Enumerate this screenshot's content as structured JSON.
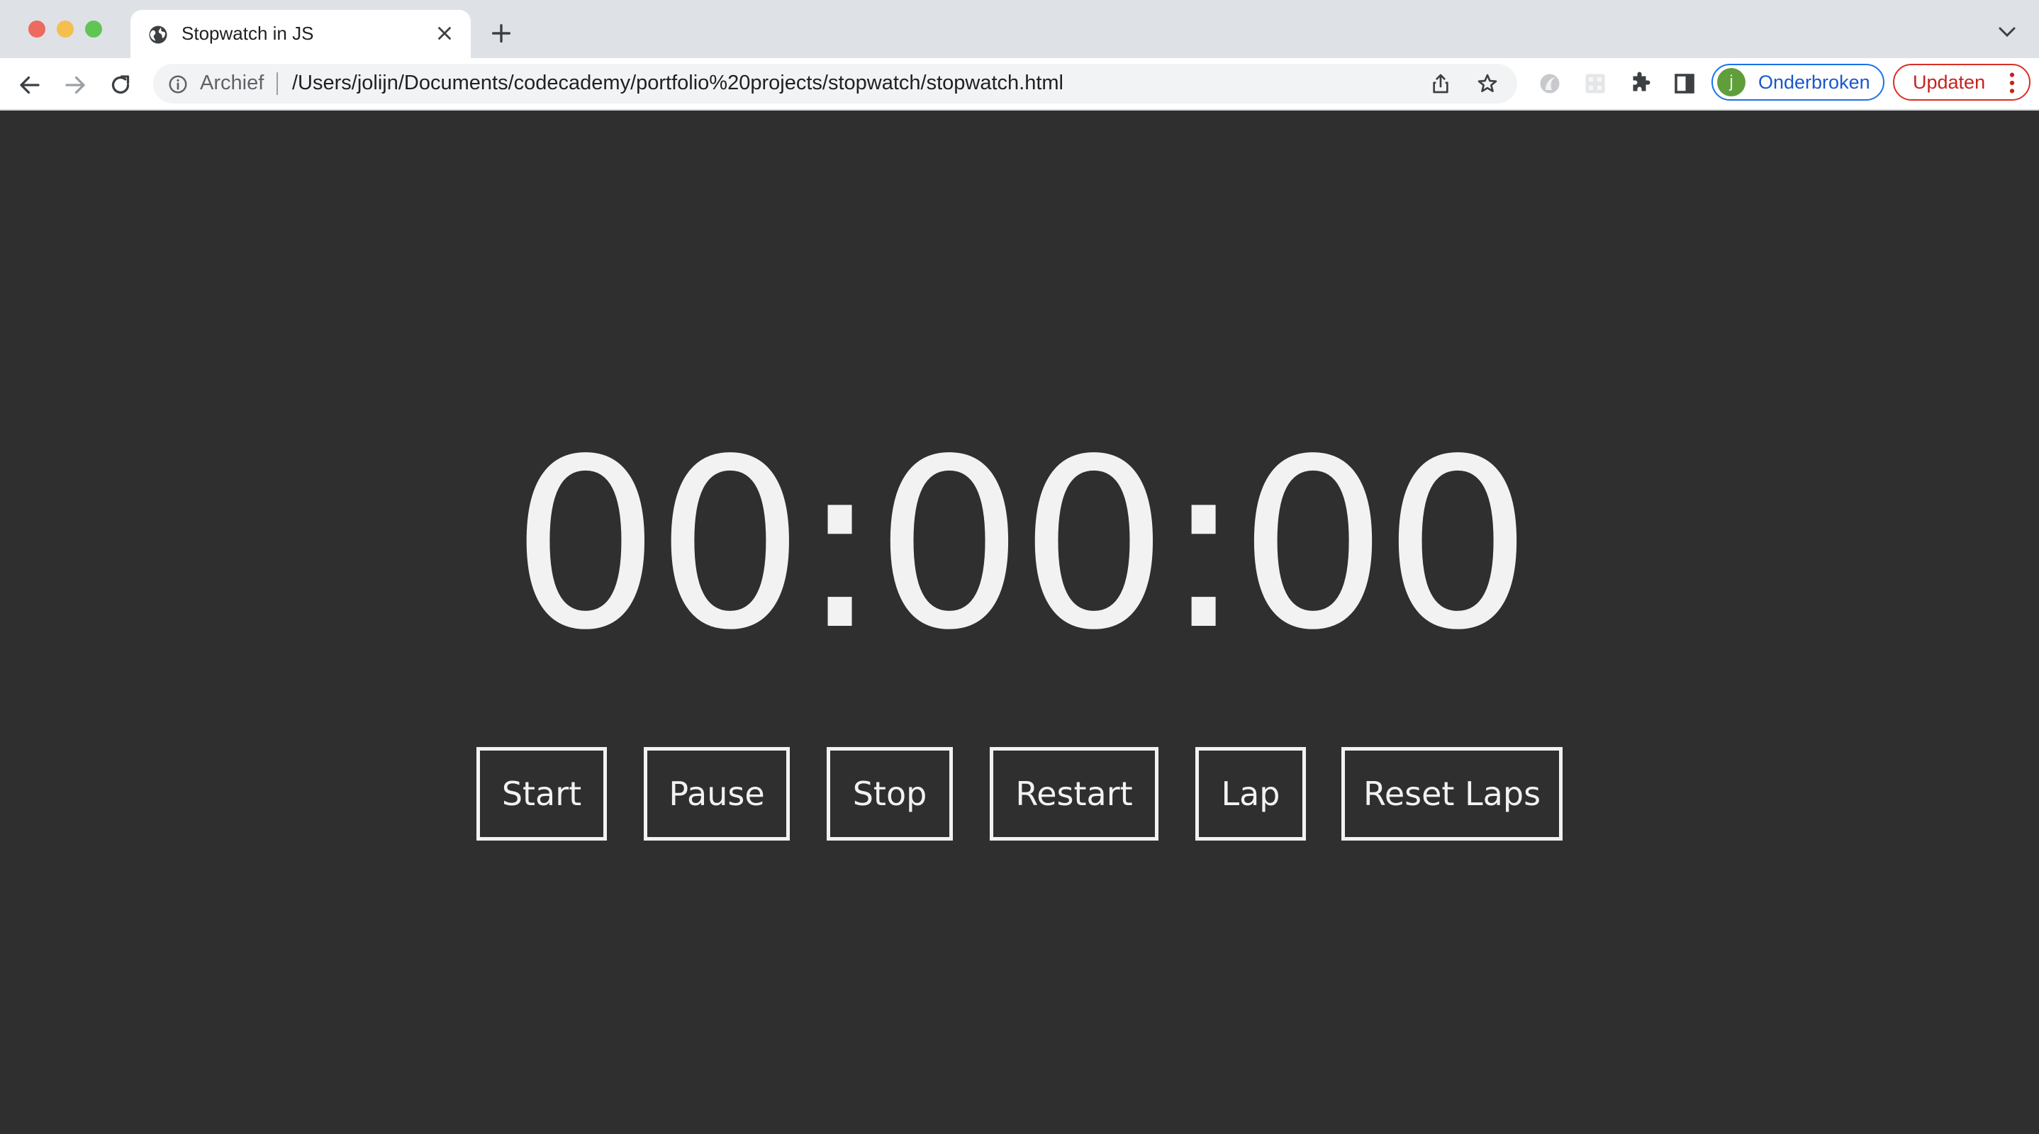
{
  "browser": {
    "tab": {
      "title": "Stopwatch in JS"
    },
    "address_bar": {
      "security_label": "Archief",
      "url": "/Users/jolijn/Documents/codecademy/portfolio%20projects/stopwatch/stopwatch.html"
    },
    "profile": {
      "initial": "j",
      "label": "Onderbroken"
    },
    "update_label": "Updaten",
    "colors": {
      "profile_accent": "#1a73e8",
      "update_accent": "#d93025"
    }
  },
  "stopwatch": {
    "display": "00:00:00",
    "buttons": {
      "start": "Start",
      "pause": "Pause",
      "stop": "Stop",
      "restart": "Restart",
      "lap": "Lap",
      "reset_laps": "Reset Laps"
    },
    "colors": {
      "background": "#2f2f2f",
      "foreground": "#f2f2f2"
    }
  }
}
